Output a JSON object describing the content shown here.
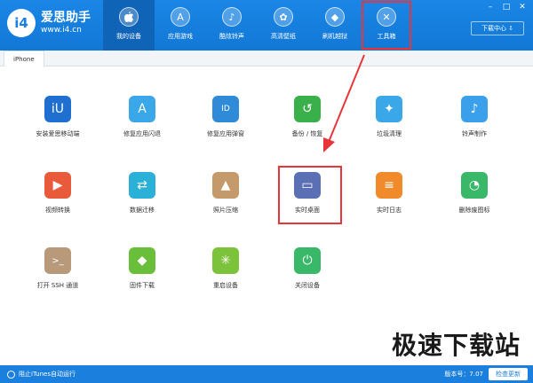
{
  "app": {
    "name": "爱思助手",
    "url": "www.i4.cn",
    "logo_mark": "i4"
  },
  "nav": [
    {
      "label": "我的设备",
      "icon": "apple-icon",
      "glyph": "",
      "active": true
    },
    {
      "label": "应用游戏",
      "icon": "appstore-icon",
      "glyph": "A"
    },
    {
      "label": "酷炫铃声",
      "icon": "bell-icon",
      "glyph": "♪"
    },
    {
      "label": "高清壁纸",
      "icon": "flower-icon",
      "glyph": "✿"
    },
    {
      "label": "刷机越狱",
      "icon": "dropbox-icon",
      "glyph": "◆"
    },
    {
      "label": "工具箱",
      "icon": "tools-icon",
      "glyph": "✕",
      "highlight": true
    }
  ],
  "window": {
    "min": "–",
    "restore": "□",
    "close": "✕",
    "download_center": "下载中心 ⇩"
  },
  "device_tab": "iPhone",
  "tools": [
    {
      "name": "安装爱思移动端",
      "icon": "i4-app-icon",
      "glyph": "iU",
      "color": "#1f6fd1"
    },
    {
      "name": "修复应用闪退",
      "icon": "appstore-repair-icon",
      "glyph": "A",
      "color": "#3aa7e8"
    },
    {
      "name": "修复应用弹窗",
      "icon": "apple-id-icon",
      "glyph": "ID",
      "color": "#2f8bd8"
    },
    {
      "name": "备份 / 恢复",
      "icon": "backup-restore-icon",
      "glyph": "↺",
      "color": "#3ab04a"
    },
    {
      "name": "垃圾清理",
      "icon": "broom-icon",
      "glyph": "✦",
      "color": "#3aa7e8"
    },
    {
      "name": "铃声制作",
      "icon": "bell-plus-icon",
      "glyph": "♪",
      "color": "#3aa0ec"
    },
    {
      "name": "视频转换",
      "icon": "video-convert-icon",
      "glyph": "▶",
      "color": "#e95a3a"
    },
    {
      "name": "数据迁移",
      "icon": "data-migrate-icon",
      "glyph": "⇄",
      "color": "#2bb0d8"
    },
    {
      "name": "照片压缩",
      "icon": "photo-compress-icon",
      "glyph": "▲",
      "color": "#c59a6a"
    },
    {
      "name": "实时桌面",
      "icon": "realtime-desktop-icon",
      "glyph": "▭",
      "color": "#5b6fb5"
    },
    {
      "name": "实时日志",
      "icon": "log-icon",
      "glyph": "≡",
      "color": "#f08a2a"
    },
    {
      "name": "删除废图标",
      "icon": "delete-icon-icon",
      "glyph": "◔",
      "color": "#3ab86a"
    },
    {
      "name": "打开 SSH 通道",
      "icon": "ssh-terminal-icon",
      "glyph": ">_",
      "color": "#b89a7a"
    },
    {
      "name": "固件下载",
      "icon": "firmware-box-icon",
      "glyph": "◆",
      "color": "#6abf3a"
    },
    {
      "name": "重启设备",
      "icon": "restart-icon",
      "glyph": "✳",
      "color": "#7cc23a"
    },
    {
      "name": "关闭设备",
      "icon": "power-icon",
      "glyph": "⏻",
      "color": "#3ab86a"
    }
  ],
  "bottom": {
    "itunes_block": "阻止iTunes自动运行",
    "version": "版本号：7.07",
    "check_update": "检查更新"
  },
  "watermark": "极速下载站"
}
